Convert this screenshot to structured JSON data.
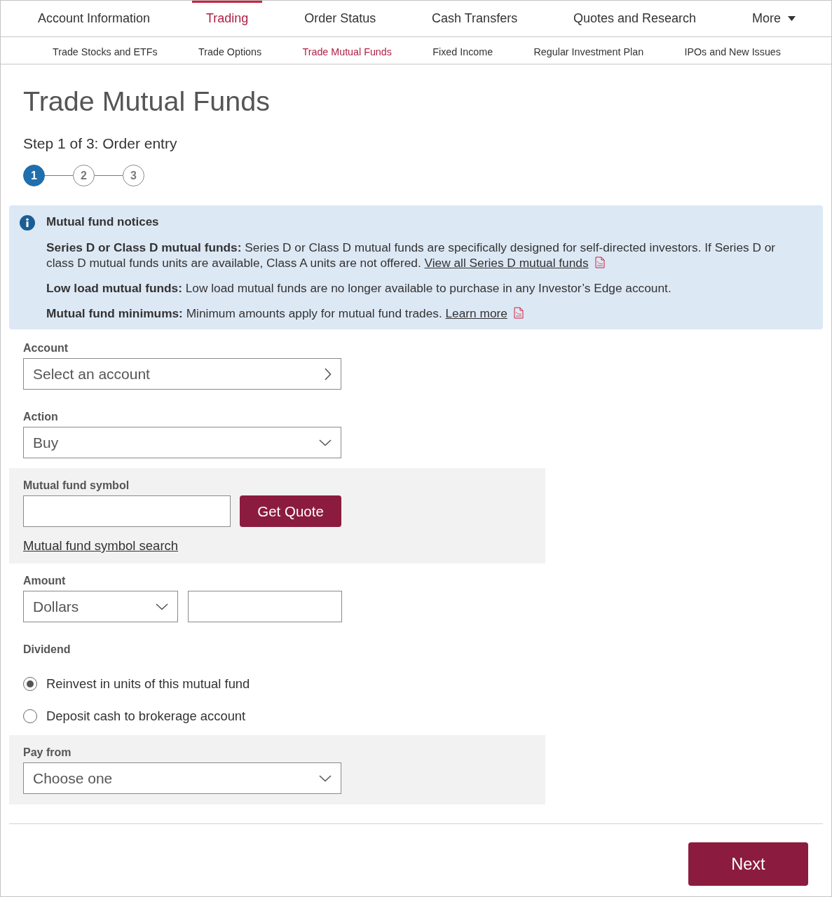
{
  "top_nav": [
    {
      "label": "Account Information",
      "selected": false,
      "kind": "link"
    },
    {
      "label": "Trading",
      "selected": true,
      "kind": "link"
    },
    {
      "label": "Order Status",
      "selected": false,
      "kind": "link"
    },
    {
      "label": "Cash Transfers",
      "selected": false,
      "kind": "link"
    },
    {
      "label": "Quotes and Research",
      "selected": false,
      "kind": "link"
    },
    {
      "label": "More",
      "selected": false,
      "kind": "menu"
    }
  ],
  "sub_nav": [
    {
      "label": "Trade Stocks and ETFs",
      "selected": false
    },
    {
      "label": "Trade Options",
      "selected": false
    },
    {
      "label": "Trade Mutual Funds",
      "selected": true
    },
    {
      "label": "Fixed Income",
      "selected": false
    },
    {
      "label": "Regular Investment Plan",
      "selected": false
    },
    {
      "label": "IPOs and New Issues",
      "selected": false
    }
  ],
  "page": {
    "title": "Trade Mutual Funds",
    "step_label": "Step 1 of 3: Order entry"
  },
  "stepper": [
    {
      "label": "1",
      "selected": true
    },
    {
      "label": "2",
      "selected": false
    },
    {
      "label": "3",
      "selected": false
    }
  ],
  "notice": {
    "title": "Mutual fund notices",
    "items": [
      {
        "text": "**Series D or Class D mutual funds:** Series D or Class D mutual funds are specifically designed for self-directed investors. If Series D or class D mutual funds units are available, Class A units are not offered.",
        "link": "View all Series D mutual funds"
      },
      {
        "text": "**Low load mutual funds:** Low load mutual funds are no longer available to purchase in any Investor’s Edge account."
      },
      {
        "text": "**Mutual fund minimums:** Minimum amounts apply for mutual fund trades.",
        "link": "Learn more"
      }
    ]
  },
  "fields": [
    {
      "kind": "picker",
      "label": "Account",
      "value": "Select an account",
      "shaded": false
    },
    {
      "kind": "select",
      "label": "Action",
      "value": "Buy",
      "shaded": false
    },
    {
      "kind": "symbol",
      "label": "Mutual fund symbol",
      "button": "Get Quote",
      "link": "Mutual fund symbol search",
      "shaded": true
    },
    {
      "kind": "amount",
      "label": "Amount",
      "unit": "Dollars",
      "shaded": false
    },
    {
      "kind": "radio",
      "label": "Dividend",
      "options": [
        {
          "label": "Reinvest in units of this mutual fund",
          "selected": true
        },
        {
          "label": "Deposit cash to brokerage account",
          "selected": false
        }
      ],
      "shaded": false
    },
    {
      "kind": "select",
      "label": "Pay from",
      "value": "Choose one",
      "shaded": true
    }
  ],
  "next_button": "Next"
}
